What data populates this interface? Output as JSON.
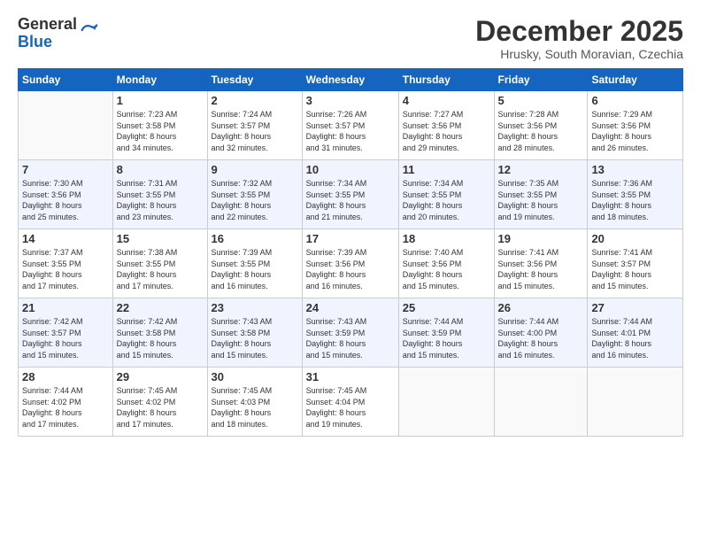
{
  "logo": {
    "general": "General",
    "blue": "Blue"
  },
  "header": {
    "month": "December 2025",
    "location": "Hrusky, South Moravian, Czechia"
  },
  "days_of_week": [
    "Sunday",
    "Monday",
    "Tuesday",
    "Wednesday",
    "Thursday",
    "Friday",
    "Saturday"
  ],
  "weeks": [
    [
      {
        "day": "",
        "info": ""
      },
      {
        "day": "1",
        "info": "Sunrise: 7:23 AM\nSunset: 3:58 PM\nDaylight: 8 hours\nand 34 minutes."
      },
      {
        "day": "2",
        "info": "Sunrise: 7:24 AM\nSunset: 3:57 PM\nDaylight: 8 hours\nand 32 minutes."
      },
      {
        "day": "3",
        "info": "Sunrise: 7:26 AM\nSunset: 3:57 PM\nDaylight: 8 hours\nand 31 minutes."
      },
      {
        "day": "4",
        "info": "Sunrise: 7:27 AM\nSunset: 3:56 PM\nDaylight: 8 hours\nand 29 minutes."
      },
      {
        "day": "5",
        "info": "Sunrise: 7:28 AM\nSunset: 3:56 PM\nDaylight: 8 hours\nand 28 minutes."
      },
      {
        "day": "6",
        "info": "Sunrise: 7:29 AM\nSunset: 3:56 PM\nDaylight: 8 hours\nand 26 minutes."
      }
    ],
    [
      {
        "day": "7",
        "info": "Sunrise: 7:30 AM\nSunset: 3:56 PM\nDaylight: 8 hours\nand 25 minutes."
      },
      {
        "day": "8",
        "info": "Sunrise: 7:31 AM\nSunset: 3:55 PM\nDaylight: 8 hours\nand 23 minutes."
      },
      {
        "day": "9",
        "info": "Sunrise: 7:32 AM\nSunset: 3:55 PM\nDaylight: 8 hours\nand 22 minutes."
      },
      {
        "day": "10",
        "info": "Sunrise: 7:34 AM\nSunset: 3:55 PM\nDaylight: 8 hours\nand 21 minutes."
      },
      {
        "day": "11",
        "info": "Sunrise: 7:34 AM\nSunset: 3:55 PM\nDaylight: 8 hours\nand 20 minutes."
      },
      {
        "day": "12",
        "info": "Sunrise: 7:35 AM\nSunset: 3:55 PM\nDaylight: 8 hours\nand 19 minutes."
      },
      {
        "day": "13",
        "info": "Sunrise: 7:36 AM\nSunset: 3:55 PM\nDaylight: 8 hours\nand 18 minutes."
      }
    ],
    [
      {
        "day": "14",
        "info": "Sunrise: 7:37 AM\nSunset: 3:55 PM\nDaylight: 8 hours\nand 17 minutes."
      },
      {
        "day": "15",
        "info": "Sunrise: 7:38 AM\nSunset: 3:55 PM\nDaylight: 8 hours\nand 17 minutes."
      },
      {
        "day": "16",
        "info": "Sunrise: 7:39 AM\nSunset: 3:55 PM\nDaylight: 8 hours\nand 16 minutes."
      },
      {
        "day": "17",
        "info": "Sunrise: 7:39 AM\nSunset: 3:56 PM\nDaylight: 8 hours\nand 16 minutes."
      },
      {
        "day": "18",
        "info": "Sunrise: 7:40 AM\nSunset: 3:56 PM\nDaylight: 8 hours\nand 15 minutes."
      },
      {
        "day": "19",
        "info": "Sunrise: 7:41 AM\nSunset: 3:56 PM\nDaylight: 8 hours\nand 15 minutes."
      },
      {
        "day": "20",
        "info": "Sunrise: 7:41 AM\nSunset: 3:57 PM\nDaylight: 8 hours\nand 15 minutes."
      }
    ],
    [
      {
        "day": "21",
        "info": "Sunrise: 7:42 AM\nSunset: 3:57 PM\nDaylight: 8 hours\nand 15 minutes."
      },
      {
        "day": "22",
        "info": "Sunrise: 7:42 AM\nSunset: 3:58 PM\nDaylight: 8 hours\nand 15 minutes."
      },
      {
        "day": "23",
        "info": "Sunrise: 7:43 AM\nSunset: 3:58 PM\nDaylight: 8 hours\nand 15 minutes."
      },
      {
        "day": "24",
        "info": "Sunrise: 7:43 AM\nSunset: 3:59 PM\nDaylight: 8 hours\nand 15 minutes."
      },
      {
        "day": "25",
        "info": "Sunrise: 7:44 AM\nSunset: 3:59 PM\nDaylight: 8 hours\nand 15 minutes."
      },
      {
        "day": "26",
        "info": "Sunrise: 7:44 AM\nSunset: 4:00 PM\nDaylight: 8 hours\nand 16 minutes."
      },
      {
        "day": "27",
        "info": "Sunrise: 7:44 AM\nSunset: 4:01 PM\nDaylight: 8 hours\nand 16 minutes."
      }
    ],
    [
      {
        "day": "28",
        "info": "Sunrise: 7:44 AM\nSunset: 4:02 PM\nDaylight: 8 hours\nand 17 minutes."
      },
      {
        "day": "29",
        "info": "Sunrise: 7:45 AM\nSunset: 4:02 PM\nDaylight: 8 hours\nand 17 minutes."
      },
      {
        "day": "30",
        "info": "Sunrise: 7:45 AM\nSunset: 4:03 PM\nDaylight: 8 hours\nand 18 minutes."
      },
      {
        "day": "31",
        "info": "Sunrise: 7:45 AM\nSunset: 4:04 PM\nDaylight: 8 hours\nand 19 minutes."
      },
      {
        "day": "",
        "info": ""
      },
      {
        "day": "",
        "info": ""
      },
      {
        "day": "",
        "info": ""
      }
    ]
  ]
}
